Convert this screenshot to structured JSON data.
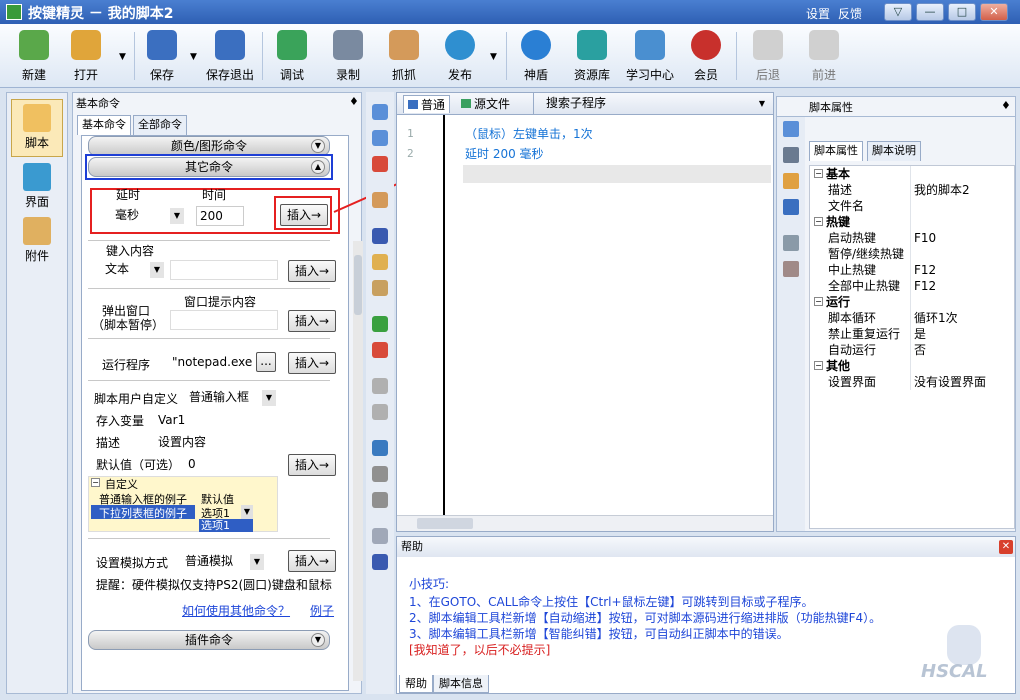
{
  "window": {
    "title": "按键精灵 － 我的脚本2",
    "links": [
      "设置",
      "反馈"
    ],
    "controls": [
      "▽",
      "—",
      "□",
      "✕"
    ]
  },
  "toolbar": {
    "items": [
      {
        "label": "新建",
        "icon": "new-doc-icon",
        "color": "#5aa84a"
      },
      {
        "label": "打开",
        "icon": "open-folder-icon",
        "color": "#e0a53a"
      },
      {
        "label": "保存",
        "icon": "save-disk-icon",
        "color": "#3b6fc0"
      },
      {
        "label": "保存退出",
        "icon": "save-exit-icon",
        "color": "#3b6fc0"
      },
      {
        "label": "调试",
        "icon": "debug-icon",
        "color": "#3aa35a"
      },
      {
        "label": "录制",
        "icon": "record-camera-icon",
        "color": "#7a8aa0"
      },
      {
        "label": "抓抓",
        "icon": "grab-hand-icon",
        "color": "#d49a5a"
      },
      {
        "label": "发布",
        "icon": "publish-globe-icon",
        "color": "#2f8fd0"
      },
      {
        "label": "神盾",
        "icon": "shield-icon",
        "color": "#2a7fd4"
      },
      {
        "label": "资源库",
        "icon": "resource-library-icon",
        "color": "#2aa0a0"
      },
      {
        "label": "学习中心",
        "icon": "learning-center-icon",
        "color": "#4a8fd0"
      },
      {
        "label": "会员",
        "icon": "member-icon",
        "color": "#c8302c"
      },
      {
        "label": "后退",
        "icon": "back-arrow-icon",
        "color": "#b8b8b8"
      },
      {
        "label": "前进",
        "icon": "forward-arrow-icon",
        "color": "#b8b8b8"
      }
    ]
  },
  "sidebar": {
    "items": [
      {
        "label": "脚本",
        "icon": "script-icon"
      },
      {
        "label": "界面",
        "icon": "interface-icon"
      },
      {
        "label": "附件",
        "icon": "attachment-icon"
      }
    ]
  },
  "leftpanel": {
    "title": "基本命令",
    "pin": "♦",
    "tabs": [
      "基本命令",
      "全部命令"
    ],
    "group_color": "颜色/图形命令",
    "group_other": "其它命令",
    "group_plugin": "插件命令",
    "delay": {
      "label_delay": "延时",
      "label_time": "时间",
      "unit": "毫秒",
      "value": "200",
      "insert": "插入→"
    },
    "key_input": {
      "label": "键入内容",
      "type": "文本",
      "value": "",
      "insert": "插入→"
    },
    "popup": {
      "label1": "弹出窗口",
      "label2": "（脚本暂停）",
      "label_content": "窗口提示内容",
      "value": "",
      "insert": "插入→"
    },
    "run": {
      "label": "运行程序",
      "value": "\"notepad.exe\"",
      "browse": "...",
      "insert": "插入→"
    },
    "custom": {
      "label": "脚本用户自定义",
      "type": "普通输入框",
      "var_label": "存入变量",
      "var_value": "Var1",
      "desc_label": "描述",
      "desc_value": "设置内容",
      "default_label": "默认值（可选）",
      "default_value": "0",
      "insert": "插入→",
      "preview": {
        "header": "自定义",
        "row1_k": "普通输入框的例子",
        "row1_v": "默认值",
        "row2_k": "下拉列表框的例子",
        "row2_v": "选项1",
        "dropdown_item": "选项1"
      }
    },
    "sim": {
      "label": "设置模拟方式",
      "value": "普通模拟",
      "insert": "插入→",
      "tip": "提醒：硬件模拟仅支持PS2(圆口)键盘和鼠标"
    },
    "links": {
      "howto": "如何使用其他命令？",
      "example": "例子"
    }
  },
  "editor": {
    "tabs": [
      "普通",
      "源文件"
    ],
    "sub_search": "搜索子程序",
    "lines": [
      {
        "num": "1",
        "text": "（鼠标）左键单击，1次"
      },
      {
        "num": "2",
        "text": "延时 200 毫秒"
      }
    ]
  },
  "props": {
    "title": "脚本属性",
    "pin": "♦",
    "tabs": [
      "脚本属性",
      "脚本说明"
    ],
    "rows": [
      {
        "cat": true,
        "k": "基本"
      },
      {
        "k": "描述",
        "v": "我的脚本2"
      },
      {
        "k": "文件名",
        "v": ""
      },
      {
        "cat": true,
        "k": "热键"
      },
      {
        "k": "启动热键",
        "v": "F10"
      },
      {
        "k": "暂停/继续热键",
        "v": ""
      },
      {
        "k": "中止热键",
        "v": "F12"
      },
      {
        "k": "全部中止热键",
        "v": "F12"
      },
      {
        "cat": true,
        "k": "运行"
      },
      {
        "k": "脚本循环",
        "v": "循环1次"
      },
      {
        "k": "禁止重复运行",
        "v": "是"
      },
      {
        "k": "自动运行",
        "v": "否"
      },
      {
        "cat": true,
        "k": "其他"
      },
      {
        "k": "设置界面",
        "v": "没有设置界面"
      }
    ]
  },
  "help": {
    "title": "帮助",
    "close": "✕",
    "lines": [
      "小技巧:",
      "1、在GOTO、CALL命令上按住【Ctrl+鼠标左键】可跳转到目标或子程序。",
      "2、脚本编辑工具栏新增【自动缩进】按钮，可对脚本源码进行缩进排版（功能热键F4）。",
      "3、脚本编辑工具栏新增【智能纠错】按钮，可自动纠正脚本中的错误。"
    ],
    "dismiss": "[我知道了，以后不必提示]",
    "tabs": [
      "帮助",
      "脚本信息"
    ],
    "logo": "HSCAL"
  },
  "colors": {
    "accent": "#1e46d8",
    "highlight_red": "#e52020",
    "highlight_blue": "#1e3fd6",
    "code": "#1573d6"
  }
}
